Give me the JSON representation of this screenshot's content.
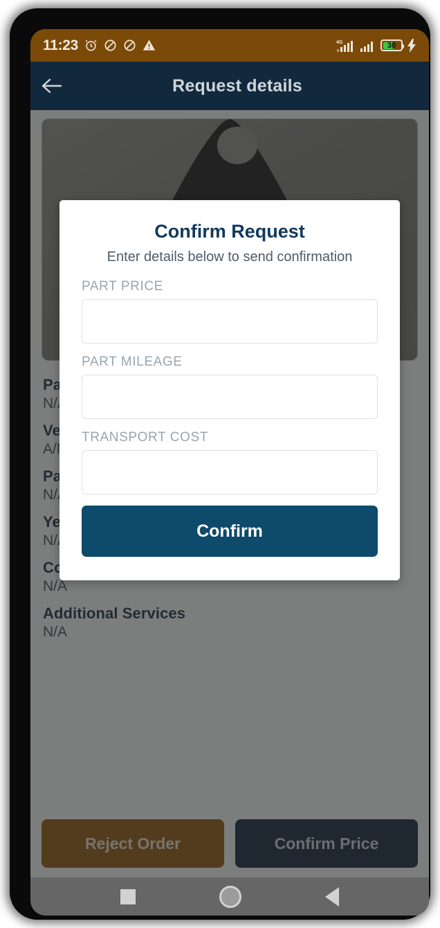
{
  "status_bar": {
    "time": "11:23",
    "battery_level": "30",
    "icons": [
      "alarm-icon",
      "mute-icon",
      "do-not-disturb-icon",
      "warning-icon",
      "signal-4g-icon",
      "signal-icon",
      "battery-icon",
      "charging-bolt-icon"
    ],
    "network_label": "4G",
    "background_color": "#7b4a09"
  },
  "app_bar": {
    "title": "Request details",
    "back_icon": "arrow-left-icon",
    "background_color": "#12293d"
  },
  "background_page": {
    "part_image_alt": "vehicle part photo",
    "details": [
      {
        "label": "Part Name",
        "value": "N/A"
      },
      {
        "label": "Vehicle",
        "value": "A/N"
      },
      {
        "label": "Part Number",
        "value": "N/A"
      },
      {
        "label": "Year",
        "value": "N/A"
      },
      {
        "label": "Condition",
        "value": "N/A"
      },
      {
        "label": "Additional Services",
        "value": "N/A"
      }
    ],
    "reject_button": "Reject Order",
    "confirm_price_button": "Confirm Price",
    "reject_color": "#8a5405",
    "confirm_price_color": "#0c2236"
  },
  "modal": {
    "title": "Confirm Request",
    "subtitle": "Enter details below to send confirmation",
    "fields": [
      {
        "label": "PART PRICE",
        "value": "",
        "placeholder": ""
      },
      {
        "label": "PART MILEAGE",
        "value": "",
        "placeholder": ""
      },
      {
        "label": "TRANSPORT COST",
        "value": "",
        "placeholder": ""
      }
    ],
    "confirm_button": "Confirm",
    "accent_color": "#0d4a6b"
  },
  "nav_bar": {
    "recents": "square-recents-icon",
    "home": "circle-home-icon",
    "back": "triangle-back-icon"
  }
}
